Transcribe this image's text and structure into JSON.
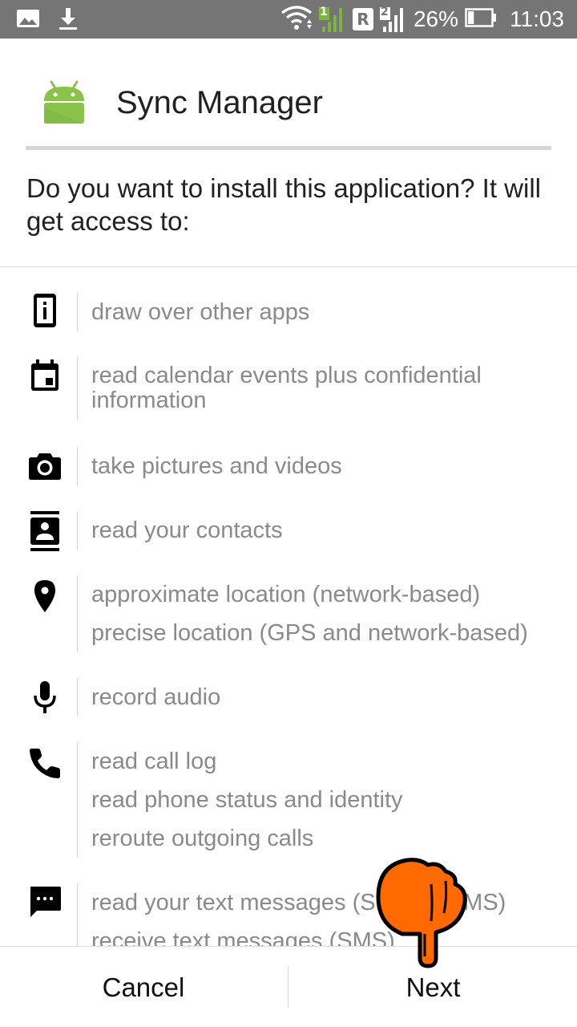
{
  "status_bar": {
    "battery_percent": "26%",
    "time": "11:03",
    "sim1_label": "1",
    "roaming_label": "R",
    "sim2_label": "2",
    "icons": [
      "image-icon",
      "download-icon",
      "wifi-icon",
      "signal-sim1-icon",
      "roaming-icon",
      "signal-sim2-icon",
      "battery-icon"
    ],
    "battery_level": 0.26
  },
  "header": {
    "title": "Sync Manager",
    "icon": "android-icon",
    "icon_color": "#8BC34A"
  },
  "question": "Do you want to install this application? It will get access to:",
  "permissions": [
    {
      "icon": "phone-info-icon",
      "lines": [
        "draw over other apps"
      ]
    },
    {
      "icon": "calendar-icon",
      "lines": [
        "read calendar events plus confidential",
        "information"
      ]
    },
    {
      "icon": "camera-icon",
      "lines": [
        "take pictures and videos"
      ]
    },
    {
      "icon": "contacts-icon",
      "lines": [
        "read your contacts"
      ]
    },
    {
      "icon": "location-icon",
      "lines": [
        "approximate location (network-based)",
        "precise location (GPS and network-based)"
      ]
    },
    {
      "icon": "microphone-icon",
      "lines": [
        "record audio"
      ]
    },
    {
      "icon": "phone-icon",
      "lines": [
        "read call log",
        "read phone status and identity",
        "reroute outgoing calls"
      ]
    },
    {
      "icon": "message-icon",
      "lines": [
        "read your text messages (SMS or MMS)",
        "receive text messages (SMS)"
      ]
    }
  ],
  "buttons": {
    "cancel": "Cancel",
    "next": "Next"
  },
  "colors": {
    "status_bar": "#757575",
    "permission_text": "#8a8a8a",
    "hand_cursor": "#FF6A00"
  }
}
